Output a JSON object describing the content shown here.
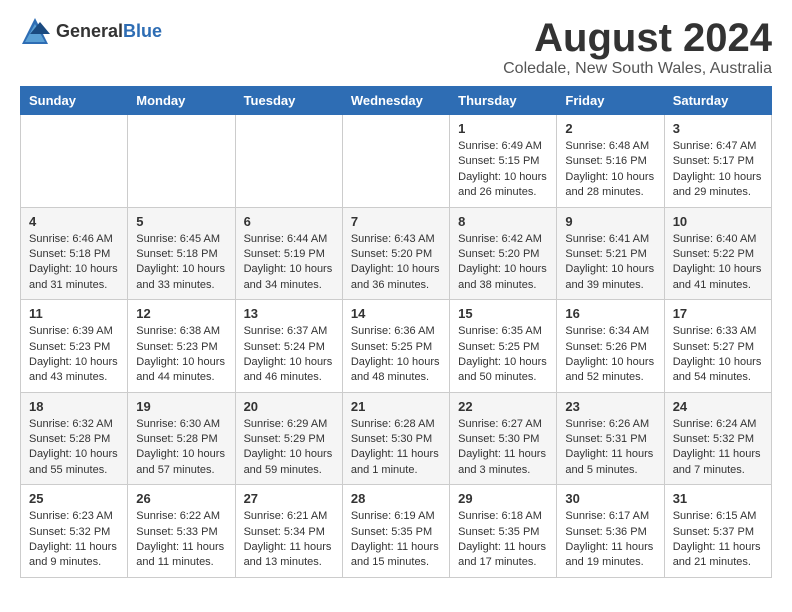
{
  "logo": {
    "general": "General",
    "blue": "Blue"
  },
  "title": "August 2024",
  "location": "Coledale, New South Wales, Australia",
  "days_of_week": [
    "Sunday",
    "Monday",
    "Tuesday",
    "Wednesday",
    "Thursday",
    "Friday",
    "Saturday"
  ],
  "weeks": [
    [
      {
        "day": "",
        "info": ""
      },
      {
        "day": "",
        "info": ""
      },
      {
        "day": "",
        "info": ""
      },
      {
        "day": "",
        "info": ""
      },
      {
        "day": "1",
        "info": "Sunrise: 6:49 AM\nSunset: 5:15 PM\nDaylight: 10 hours\nand 26 minutes."
      },
      {
        "day": "2",
        "info": "Sunrise: 6:48 AM\nSunset: 5:16 PM\nDaylight: 10 hours\nand 28 minutes."
      },
      {
        "day": "3",
        "info": "Sunrise: 6:47 AM\nSunset: 5:17 PM\nDaylight: 10 hours\nand 29 minutes."
      }
    ],
    [
      {
        "day": "4",
        "info": "Sunrise: 6:46 AM\nSunset: 5:18 PM\nDaylight: 10 hours\nand 31 minutes."
      },
      {
        "day": "5",
        "info": "Sunrise: 6:45 AM\nSunset: 5:18 PM\nDaylight: 10 hours\nand 33 minutes."
      },
      {
        "day": "6",
        "info": "Sunrise: 6:44 AM\nSunset: 5:19 PM\nDaylight: 10 hours\nand 34 minutes."
      },
      {
        "day": "7",
        "info": "Sunrise: 6:43 AM\nSunset: 5:20 PM\nDaylight: 10 hours\nand 36 minutes."
      },
      {
        "day": "8",
        "info": "Sunrise: 6:42 AM\nSunset: 5:20 PM\nDaylight: 10 hours\nand 38 minutes."
      },
      {
        "day": "9",
        "info": "Sunrise: 6:41 AM\nSunset: 5:21 PM\nDaylight: 10 hours\nand 39 minutes."
      },
      {
        "day": "10",
        "info": "Sunrise: 6:40 AM\nSunset: 5:22 PM\nDaylight: 10 hours\nand 41 minutes."
      }
    ],
    [
      {
        "day": "11",
        "info": "Sunrise: 6:39 AM\nSunset: 5:23 PM\nDaylight: 10 hours\nand 43 minutes."
      },
      {
        "day": "12",
        "info": "Sunrise: 6:38 AM\nSunset: 5:23 PM\nDaylight: 10 hours\nand 44 minutes."
      },
      {
        "day": "13",
        "info": "Sunrise: 6:37 AM\nSunset: 5:24 PM\nDaylight: 10 hours\nand 46 minutes."
      },
      {
        "day": "14",
        "info": "Sunrise: 6:36 AM\nSunset: 5:25 PM\nDaylight: 10 hours\nand 48 minutes."
      },
      {
        "day": "15",
        "info": "Sunrise: 6:35 AM\nSunset: 5:25 PM\nDaylight: 10 hours\nand 50 minutes."
      },
      {
        "day": "16",
        "info": "Sunrise: 6:34 AM\nSunset: 5:26 PM\nDaylight: 10 hours\nand 52 minutes."
      },
      {
        "day": "17",
        "info": "Sunrise: 6:33 AM\nSunset: 5:27 PM\nDaylight: 10 hours\nand 54 minutes."
      }
    ],
    [
      {
        "day": "18",
        "info": "Sunrise: 6:32 AM\nSunset: 5:28 PM\nDaylight: 10 hours\nand 55 minutes."
      },
      {
        "day": "19",
        "info": "Sunrise: 6:30 AM\nSunset: 5:28 PM\nDaylight: 10 hours\nand 57 minutes."
      },
      {
        "day": "20",
        "info": "Sunrise: 6:29 AM\nSunset: 5:29 PM\nDaylight: 10 hours\nand 59 minutes."
      },
      {
        "day": "21",
        "info": "Sunrise: 6:28 AM\nSunset: 5:30 PM\nDaylight: 11 hours\nand 1 minute."
      },
      {
        "day": "22",
        "info": "Sunrise: 6:27 AM\nSunset: 5:30 PM\nDaylight: 11 hours\nand 3 minutes."
      },
      {
        "day": "23",
        "info": "Sunrise: 6:26 AM\nSunset: 5:31 PM\nDaylight: 11 hours\nand 5 minutes."
      },
      {
        "day": "24",
        "info": "Sunrise: 6:24 AM\nSunset: 5:32 PM\nDaylight: 11 hours\nand 7 minutes."
      }
    ],
    [
      {
        "day": "25",
        "info": "Sunrise: 6:23 AM\nSunset: 5:32 PM\nDaylight: 11 hours\nand 9 minutes."
      },
      {
        "day": "26",
        "info": "Sunrise: 6:22 AM\nSunset: 5:33 PM\nDaylight: 11 hours\nand 11 minutes."
      },
      {
        "day": "27",
        "info": "Sunrise: 6:21 AM\nSunset: 5:34 PM\nDaylight: 11 hours\nand 13 minutes."
      },
      {
        "day": "28",
        "info": "Sunrise: 6:19 AM\nSunset: 5:35 PM\nDaylight: 11 hours\nand 15 minutes."
      },
      {
        "day": "29",
        "info": "Sunrise: 6:18 AM\nSunset: 5:35 PM\nDaylight: 11 hours\nand 17 minutes."
      },
      {
        "day": "30",
        "info": "Sunrise: 6:17 AM\nSunset: 5:36 PM\nDaylight: 11 hours\nand 19 minutes."
      },
      {
        "day": "31",
        "info": "Sunrise: 6:15 AM\nSunset: 5:37 PM\nDaylight: 11 hours\nand 21 minutes."
      }
    ]
  ]
}
